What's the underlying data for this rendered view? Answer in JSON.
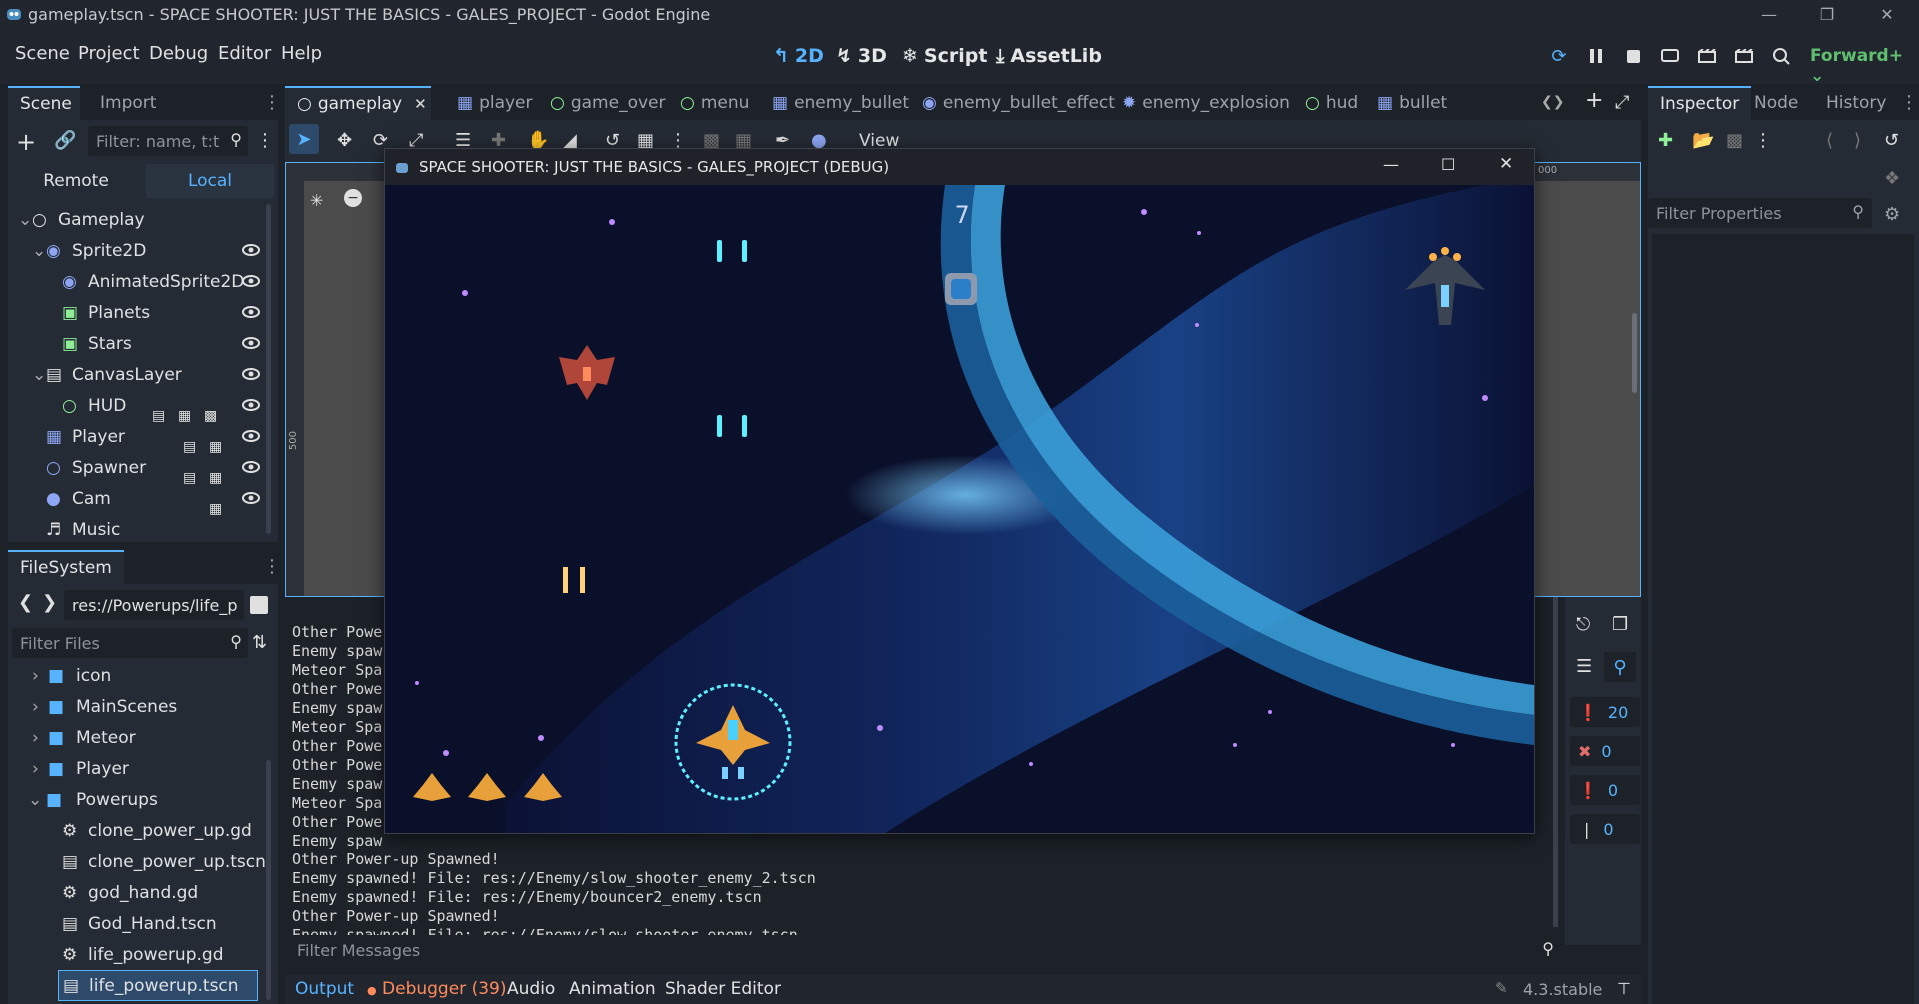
{
  "window": {
    "title": "gameplay.tscn - SPACE SHOOTER: JUST THE BASICS - GALES_PROJECT - Godot Engine"
  },
  "menu": [
    "Scene",
    "Project",
    "Debug",
    "Editor",
    "Help"
  ],
  "workspaces": [
    "2D",
    "3D",
    "Script",
    "AssetLib"
  ],
  "renderer": "Forward+",
  "left_dock": {
    "tabs": [
      "Scene",
      "Import"
    ],
    "filter_placeholder": "Filter: name, t:t",
    "mode_tabs": [
      "Remote",
      "Local"
    ],
    "tree": [
      {
        "label": "Gameplay",
        "icon": "node-circle-icon"
      },
      {
        "label": "Sprite2D",
        "icon": "sprite-icon"
      },
      {
        "label": "AnimatedSprite2D",
        "icon": "animated-sprite-icon"
      },
      {
        "label": "Planets",
        "icon": "image-icon"
      },
      {
        "label": "Stars",
        "icon": "image-icon"
      },
      {
        "label": "CanvasLayer",
        "icon": "canvas-layer-icon"
      },
      {
        "label": "HUD",
        "icon": "control-icon"
      },
      {
        "label": "Player",
        "icon": "instance-icon"
      },
      {
        "label": "Spawner",
        "icon": "node-circle-icon"
      },
      {
        "label": "Cam",
        "icon": "camera-icon"
      },
      {
        "label": "Music",
        "icon": "speaker-icon"
      }
    ]
  },
  "filesystem": {
    "tab": "FileSystem",
    "path": "res://Powerups/life_p",
    "filter_placeholder": "Filter Files",
    "items": [
      {
        "label": "icon",
        "type": "folder"
      },
      {
        "label": "MainScenes",
        "type": "folder"
      },
      {
        "label": "Meteor",
        "type": "folder"
      },
      {
        "label": "Player",
        "type": "folder"
      },
      {
        "label": "Powerups",
        "type": "folder"
      },
      {
        "label": "clone_power_up.gd",
        "type": "script"
      },
      {
        "label": "clone_power_up.tscn",
        "type": "scene"
      },
      {
        "label": "god_hand.gd",
        "type": "script"
      },
      {
        "label": "God_Hand.tscn",
        "type": "scene"
      },
      {
        "label": "life_powerup.gd",
        "type": "script"
      },
      {
        "label": "life_powerup.tscn",
        "type": "scene"
      }
    ]
  },
  "scene_tabs": [
    "gameplay",
    "player",
    "game_over",
    "menu",
    "enemy_bullet",
    "enemy_bullet_effect",
    "enemy_explosion",
    "hud",
    "bullet"
  ],
  "toolbar": {
    "view_label": "View"
  },
  "ruler": {
    "label_1": "000",
    "label_2": "500"
  },
  "game_window": {
    "title": "SPACE SHOOTER: JUST THE BASICS - GALES_PROJECT (DEBUG)",
    "score": "7"
  },
  "output": {
    "hidden_lines": [
      "Other Powe",
      "Enemy spaw",
      "Meteor Spa",
      "Other Powe",
      "Enemy spaw",
      "Meteor Spa",
      "Other Powe",
      "Other Powe",
      "Enemy spaw",
      "Meteor Spa",
      "Other Powe",
      "Enemy spaw"
    ],
    "lines": [
      "Other Power-up Spawned!",
      "Enemy spawned! File: res://Enemy/slow_shooter_enemy_2.tscn",
      "Enemy spawned! File: res://Enemy/bouncer2_enemy.tscn",
      "Other Power-up Spawned!",
      "Enemy spawned! File: res://Enemy/slow_shooter_enemy.tscn"
    ],
    "filter_placeholder": "Filter Messages",
    "counts": {
      "messages": "20",
      "errors": "0",
      "warnings": "0",
      "info": "0"
    }
  },
  "bottom_tabs": [
    "Output",
    "Debugger (39)",
    "Audio",
    "Animation",
    "Shader Editor"
  ],
  "version": "4.3.stable",
  "inspector": {
    "tabs": [
      "Inspector",
      "Node",
      "History"
    ],
    "filter_placeholder": "Filter Properties"
  },
  "colors": {
    "accent": "#57b3ff",
    "bg": "#1d2229",
    "panel": "#252b34",
    "error": "#e06c6c",
    "warning": "#f5c542"
  }
}
